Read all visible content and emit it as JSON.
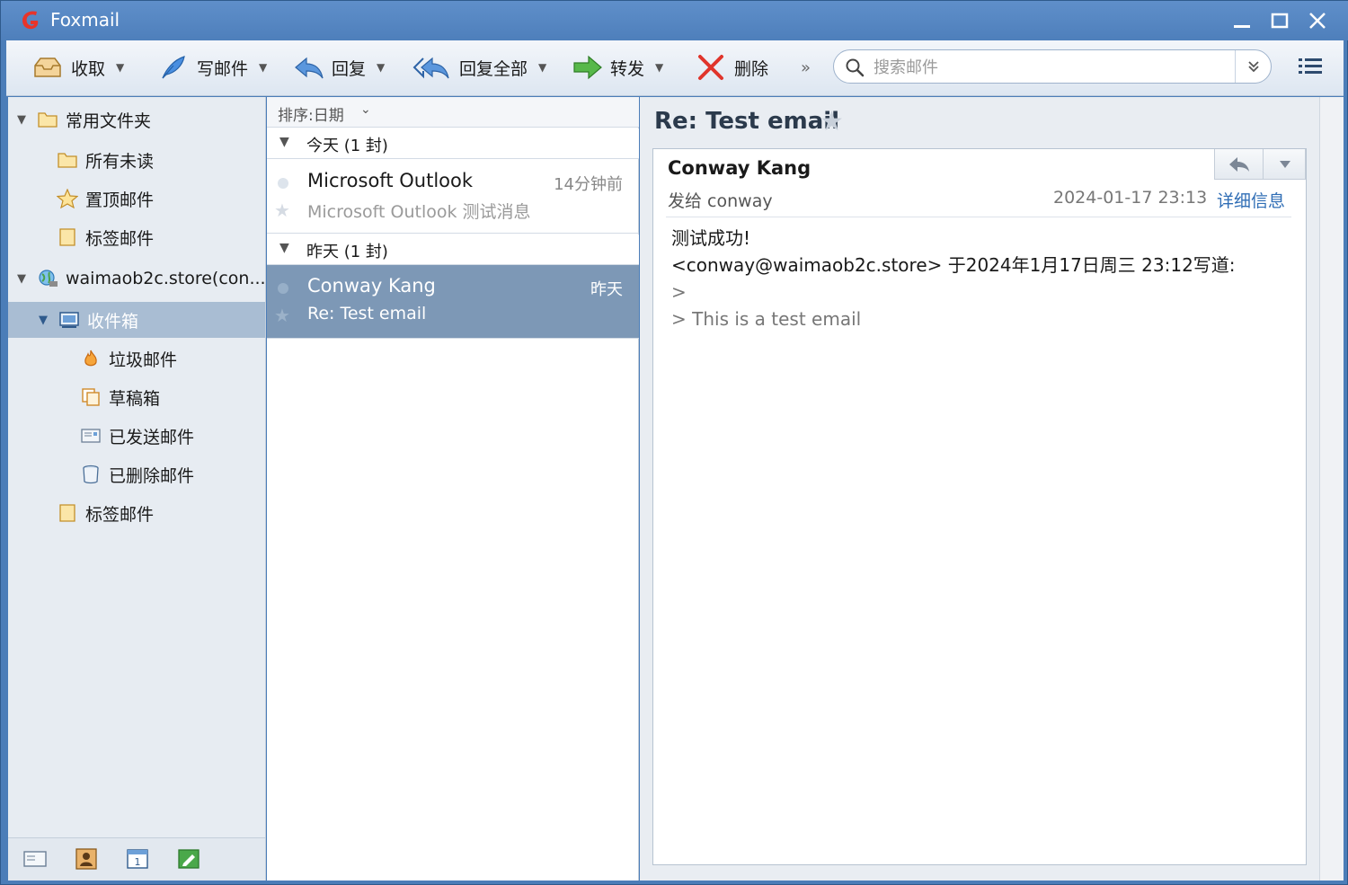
{
  "window": {
    "title": "Foxmail"
  },
  "toolbar": {
    "receive_label": "收取",
    "compose_label": "写邮件",
    "reply_label": "回复",
    "reply_all_label": "回复全部",
    "forward_label": "转发",
    "delete_label": "删除",
    "more_label": "»",
    "search_placeholder": "搜索邮件"
  },
  "folders": {
    "favorites": "常用文件夹",
    "all_unread": "所有未读",
    "pinned": "置顶邮件",
    "tagged": "标签邮件",
    "account": "waimaob2c.store(con...",
    "inbox": "收件箱",
    "junk": "垃圾邮件",
    "drafts": "草稿箱",
    "sent": "已发送邮件",
    "deleted": "已删除邮件",
    "tagged2": "标签邮件"
  },
  "list": {
    "sort_label": "排序:日期",
    "groups": [
      {
        "label": "今天 (1 封)"
      },
      {
        "label": "昨天 (1 封)"
      }
    ],
    "messages": [
      {
        "from": "Microsoft Outlook",
        "time": "14分钟前",
        "subject": "Microsoft Outlook 测试消息"
      },
      {
        "from": "Conway Kang",
        "time": "昨天",
        "subject": "Re: Test email"
      }
    ]
  },
  "reader": {
    "subject": "Re: Test email",
    "sender": "Conway Kang",
    "to": "发给 conway",
    "date": "2024-01-17 23:13",
    "details_link": "详细信息",
    "body": [
      "测试成功!",
      "",
      "<conway@waimaob2c.store> 于2024年1月17日周三 23:12写道:",
      ">",
      "> This is a test email"
    ]
  },
  "colors": {
    "title_bar": "#5f8fca",
    "selection": "#7d98b6",
    "folder_selection": "#a9bdd3",
    "link": "#2f6db5"
  }
}
